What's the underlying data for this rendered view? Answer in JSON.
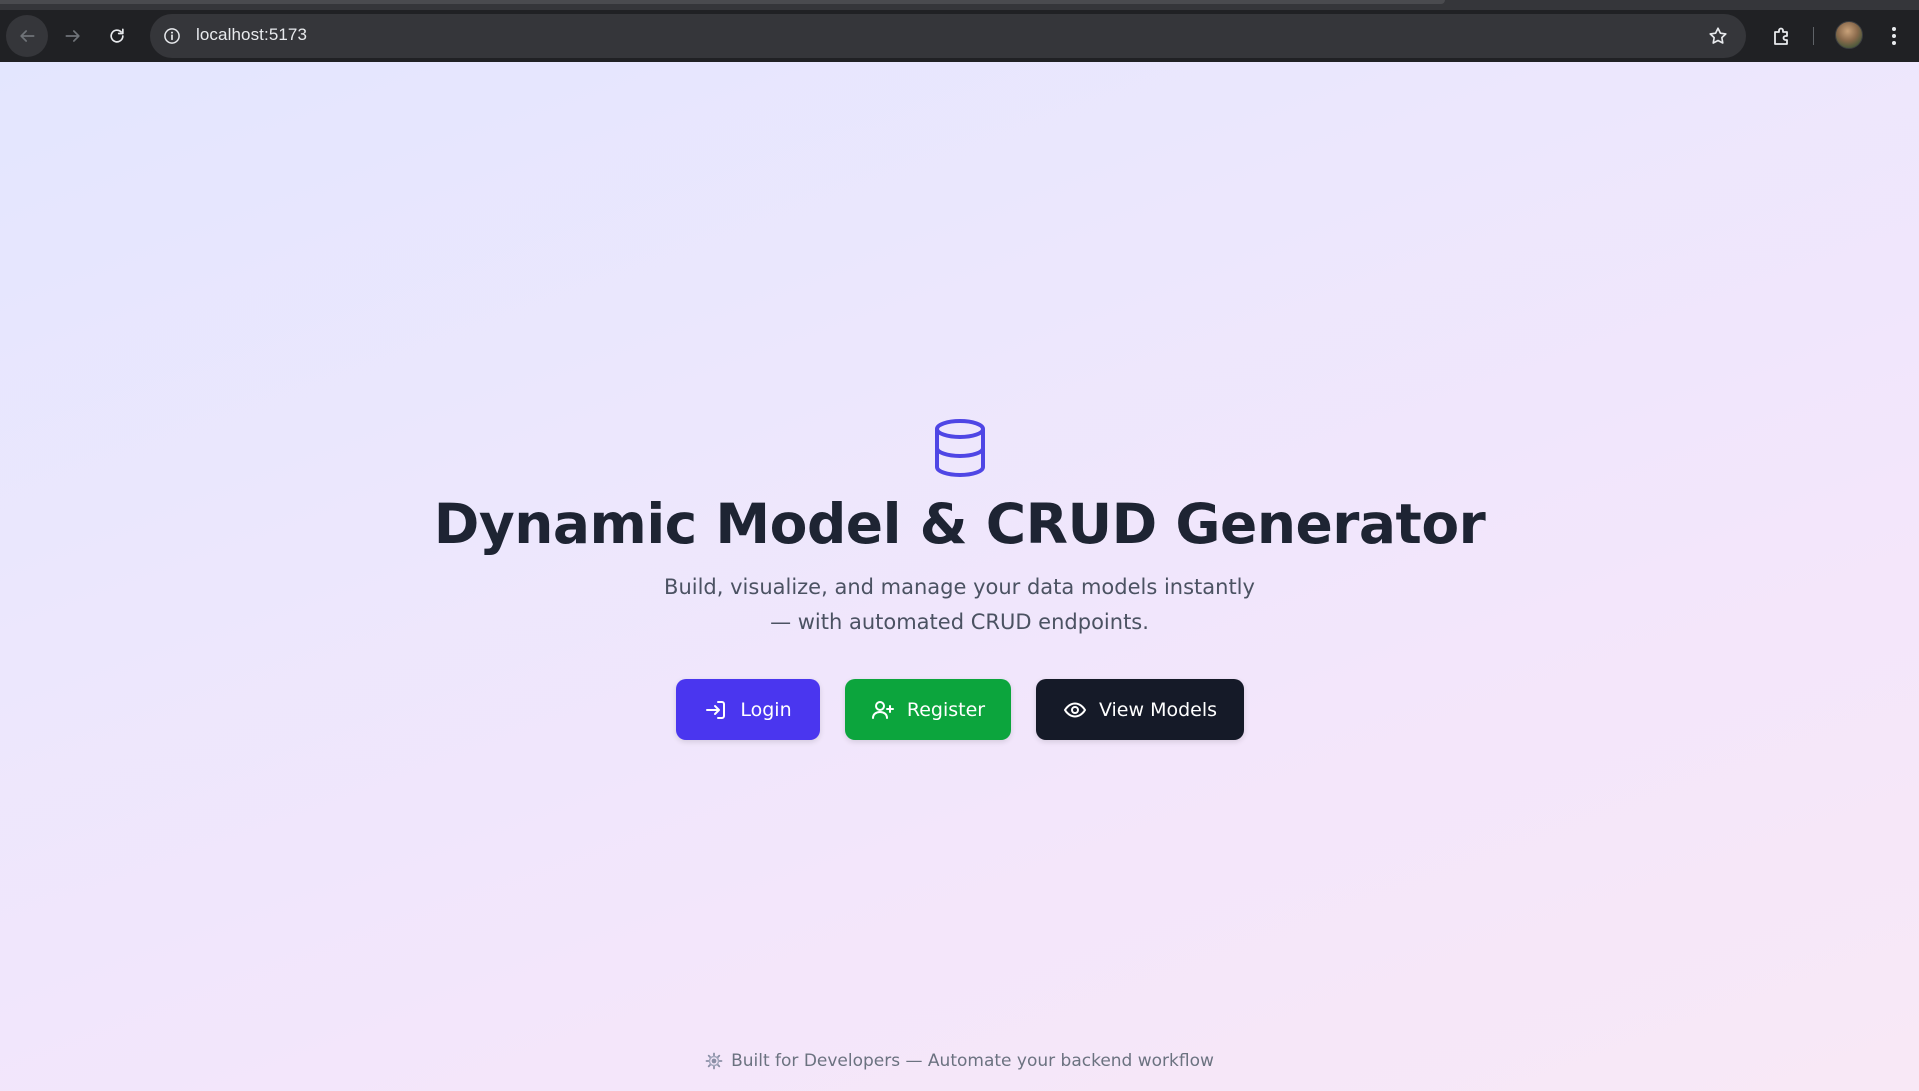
{
  "browser": {
    "url": "localhost:5173",
    "icons": {
      "back": "arrow-left-icon",
      "forward": "arrow-right-icon",
      "reload": "reload-icon",
      "site_info": "info-icon",
      "bookmark": "star-icon",
      "extensions": "puzzle-icon",
      "profile": "avatar",
      "menu": "kebab-menu-icon"
    }
  },
  "hero": {
    "icon": "database-icon",
    "title": "Dynamic Model & CRUD Generator",
    "subtitle_line1": "Build, visualize, and manage your data models instantly",
    "subtitle_line2": "— with automated CRUD endpoints.",
    "buttons": {
      "login": {
        "label": "Login",
        "icon": "login-icon",
        "color": "#4a36ef"
      },
      "register": {
        "label": "Register",
        "icon": "user-plus-icon",
        "color": "#0ca53d"
      },
      "view_models": {
        "label": "View Models",
        "icon": "eye-icon",
        "color": "#151a28"
      }
    }
  },
  "footer": {
    "icon": "gear-icon",
    "text": "Built for Developers — Automate your backend workflow"
  },
  "colors": {
    "title": "#1e2433",
    "accent": "#4f46e5"
  }
}
